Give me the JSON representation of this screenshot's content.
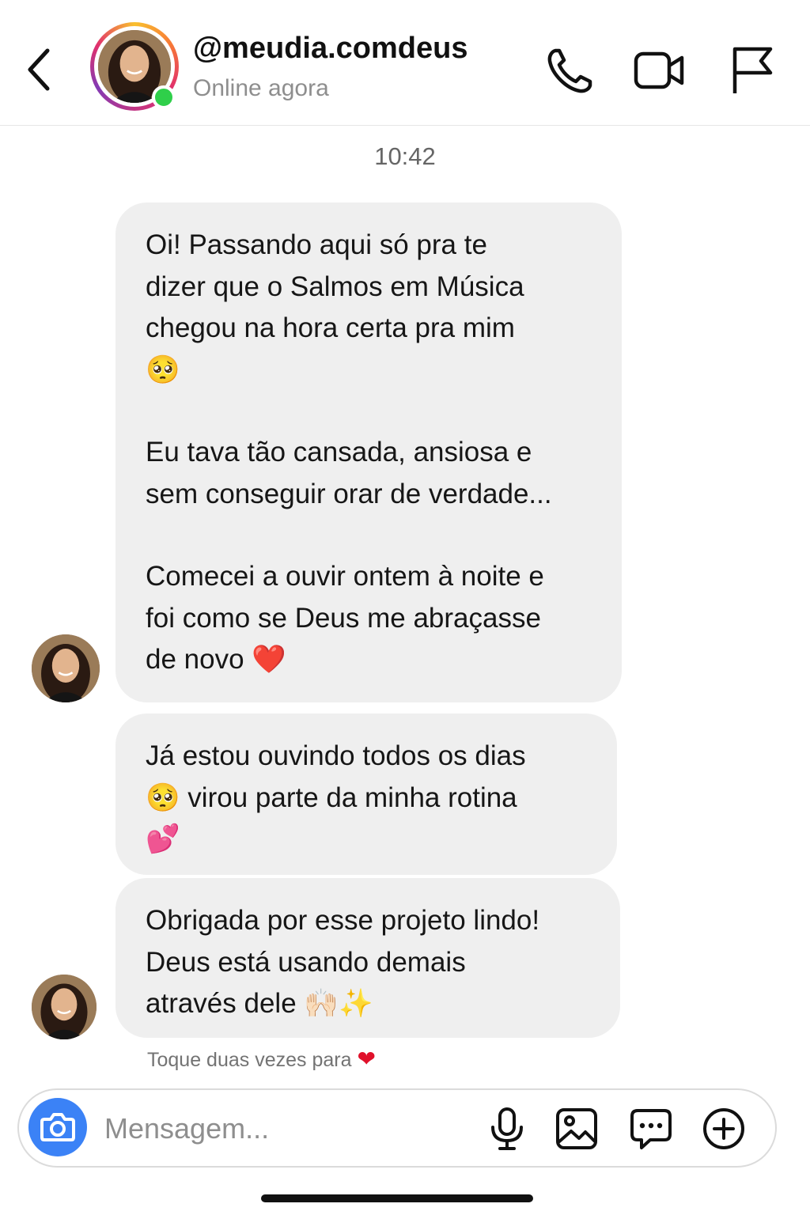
{
  "header": {
    "username": "@meudia.comdeus",
    "status": "Online agora",
    "icons": [
      "back-chevron-icon",
      "phone-icon",
      "video-camera-icon",
      "flag-icon"
    ]
  },
  "conversation": {
    "timestamp": "10:42",
    "messages": [
      {
        "paragraphs": [
          "Oi! Passando aqui só pra te\ndizer que o Salmos em Música\nchegou na hora certa pra mim\n🥺",
          "Eu tava tão cansada, ansiosa e\nsem conseguir orar de verdade...",
          "Comecei a ouvir ontem à noite e\nfoi como se Deus me abraçasse\nde novo ❤️"
        ]
      },
      {
        "paragraphs": [
          "Já estou ouvindo todos os dias\n🥺 virou parte da minha rotina\n💕"
        ]
      },
      {
        "paragraphs": [
          "Obrigada por esse projeto lindo!\nDeus está usando demais\natravés dele 🙌🏻✨"
        ]
      }
    ],
    "reaction_hint": "Toque duas vezes para",
    "reaction_emoji": "❤"
  },
  "composer": {
    "placeholder": "Mensagem...",
    "icons": [
      "camera-icon",
      "microphone-icon",
      "gallery-icon",
      "sticker-chat-icon",
      "add-circle-icon"
    ]
  },
  "colors": {
    "accent_blue": "#3b82f6",
    "online_green": "#2fcf4a",
    "bubble_bg": "#efefef",
    "heart_red": "#e0112b"
  }
}
